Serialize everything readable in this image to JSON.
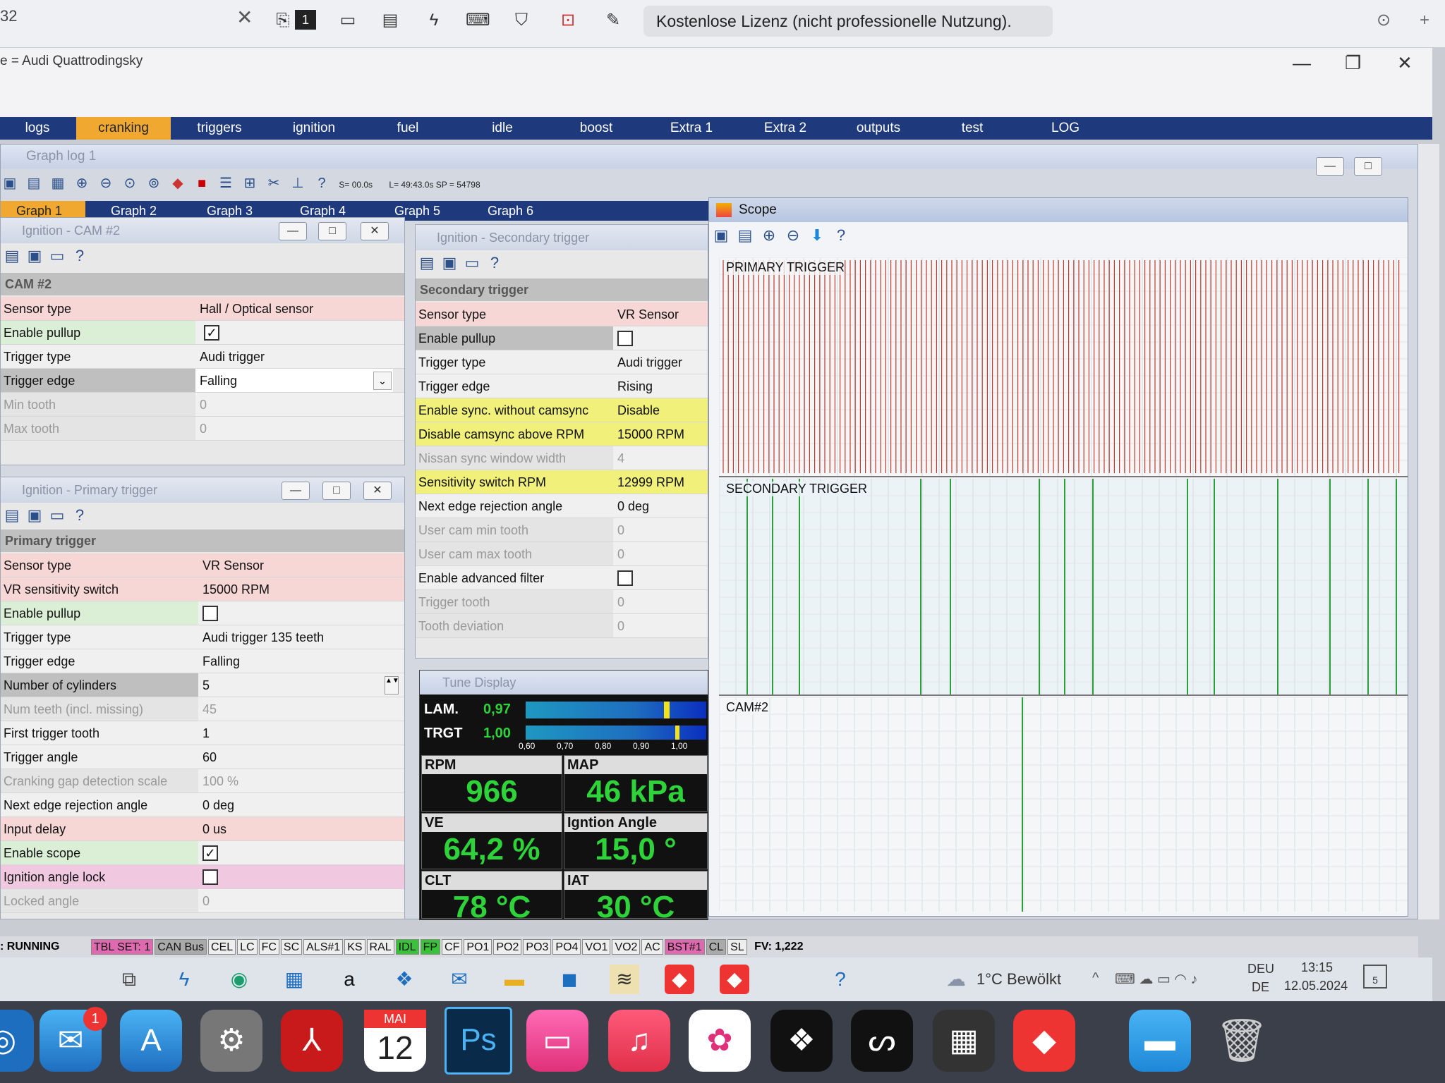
{
  "topbar": {
    "number": "32",
    "close": "✕",
    "license": "Kostenlose Lizenz (nicht professionelle Nutzung).",
    "plus": "+"
  },
  "window": {
    "title": "e = Audi Quattrodingsky",
    "minimize": "—",
    "restore": "❐",
    "close": "✕"
  },
  "tabs": [
    "logs",
    "cranking",
    "triggers",
    "ignition",
    "fuel",
    "idle",
    "boost",
    "Extra 1",
    "Extra 2",
    "outputs",
    "test",
    "LOG"
  ],
  "graph_log": {
    "title": "Graph log 1",
    "s_label": "S= 00.0s",
    "l_label": "L= 49:43.0s  SP = 54798",
    "tabs": [
      "Graph 1",
      "Graph 2",
      "Graph 3",
      "Graph 4",
      "Graph 5",
      "Graph 6"
    ]
  },
  "cam2": {
    "title": "Ignition - CAM #2",
    "group": "CAM #2",
    "rows": [
      {
        "k": "Sensor type",
        "v": "Hall / Optical sensor"
      },
      {
        "k": "Enable pullup",
        "v": "✓"
      },
      {
        "k": "Trigger type",
        "v": "Audi trigger"
      },
      {
        "k": "Trigger edge",
        "v": "Falling"
      },
      {
        "k": "Min tooth",
        "v": "0"
      },
      {
        "k": "Max tooth",
        "v": "0"
      }
    ]
  },
  "primary": {
    "title": "Ignition - Primary trigger",
    "group": "Primary trigger",
    "rows": [
      {
        "k": "Sensor type",
        "v": "VR Sensor"
      },
      {
        "k": "VR sensitivity switch",
        "v": "15000 RPM"
      },
      {
        "k": "Enable pullup",
        "v": ""
      },
      {
        "k": "Trigger type",
        "v": "Audi trigger 135 teeth"
      },
      {
        "k": "Trigger edge",
        "v": "Falling"
      },
      {
        "k": "Number of cylinders",
        "v": "5"
      },
      {
        "k": "Num teeth (incl. missing)",
        "v": "45"
      },
      {
        "k": "First trigger tooth",
        "v": "1"
      },
      {
        "k": "Trigger angle",
        "v": "60"
      },
      {
        "k": "Cranking gap detection scale",
        "v": "100 %"
      },
      {
        "k": "Next edge rejection angle",
        "v": "0 deg"
      },
      {
        "k": "Input delay",
        "v": "0 us"
      },
      {
        "k": "Enable scope",
        "v": "✓"
      },
      {
        "k": "Ignition angle lock",
        "v": ""
      },
      {
        "k": "Locked angle",
        "v": "0"
      }
    ]
  },
  "secondary": {
    "title": "Ignition - Secondary trigger",
    "group": "Secondary trigger",
    "rows": [
      {
        "k": "Sensor type",
        "v": "VR Sensor"
      },
      {
        "k": "Enable pullup",
        "v": ""
      },
      {
        "k": "Trigger type",
        "v": "Audi trigger"
      },
      {
        "k": "Trigger edge",
        "v": "Rising"
      },
      {
        "k": "Enable sync. without camsync",
        "v": "Disable"
      },
      {
        "k": "Disable camsync above RPM",
        "v": "15000 RPM"
      },
      {
        "k": "Nissan sync window width",
        "v": "4"
      },
      {
        "k": "Sensitivity switch RPM",
        "v": "12999 RPM"
      },
      {
        "k": "Next edge rejection angle",
        "v": "0 deg"
      },
      {
        "k": "User cam min tooth",
        "v": "0"
      },
      {
        "k": "User cam max tooth",
        "v": "0"
      },
      {
        "k": "Enable advanced filter",
        "v": ""
      },
      {
        "k": "Trigger tooth",
        "v": "0"
      },
      {
        "k": "Tooth deviation",
        "v": "0"
      }
    ]
  },
  "tune": {
    "title": "Tune Display",
    "lam_label": "LAM.",
    "lam_value": "0,97",
    "trgt_label": "TRGT",
    "trgt_value": "1,00",
    "lam_level": 0.97,
    "trgt_level": 1.0,
    "scale": [
      "0,60",
      "0,70",
      "0,80",
      "0,90",
      "1,00"
    ],
    "gauges": [
      {
        "label": "RPM",
        "value": "966"
      },
      {
        "label": "MAP",
        "value": "46 kPa"
      },
      {
        "label": "VE",
        "value": "64,2 %"
      },
      {
        "label": "Igntion Angle",
        "value": "15,0 °"
      },
      {
        "label": "CLT",
        "value": "78 °C"
      },
      {
        "label": "IAT",
        "value": "30 °C"
      }
    ]
  },
  "scope": {
    "title": "Scope",
    "traces": [
      "PRIMARY TRIGGER",
      "SECONDARY TRIGGER",
      "CAM#2"
    ]
  },
  "status": {
    "running": ": RUNNING",
    "badges": [
      "TBL SET: 1",
      "CAN Bus",
      "CEL",
      "LC",
      "FC",
      "SC",
      "ALS#1",
      "KS",
      "RAL",
      "IDL",
      "FP",
      "CF",
      "PO1",
      "PO2",
      "PO3",
      "PO4",
      "VO1",
      "VO2",
      "AC",
      "BST#1",
      "CL",
      "SL"
    ],
    "fv": "FV: 1,222"
  },
  "taskbar": {
    "weather": "1°C  Bewölkt",
    "lang1": "DEU",
    "lang2": "DE",
    "time": "13:15",
    "date": "12.05.2024",
    "notif": "5"
  },
  "dock": {
    "mail_badge": "1",
    "cal_month": "MAI",
    "cal_day": "12",
    "ps": "Ps"
  },
  "colors": {
    "tabbar": "#1e3a7d",
    "active_tab": "#f0a830",
    "gauge_green": "#2ed33a",
    "trace_primary": "#c0392b",
    "trace_secondary": "#2e9e3a"
  }
}
